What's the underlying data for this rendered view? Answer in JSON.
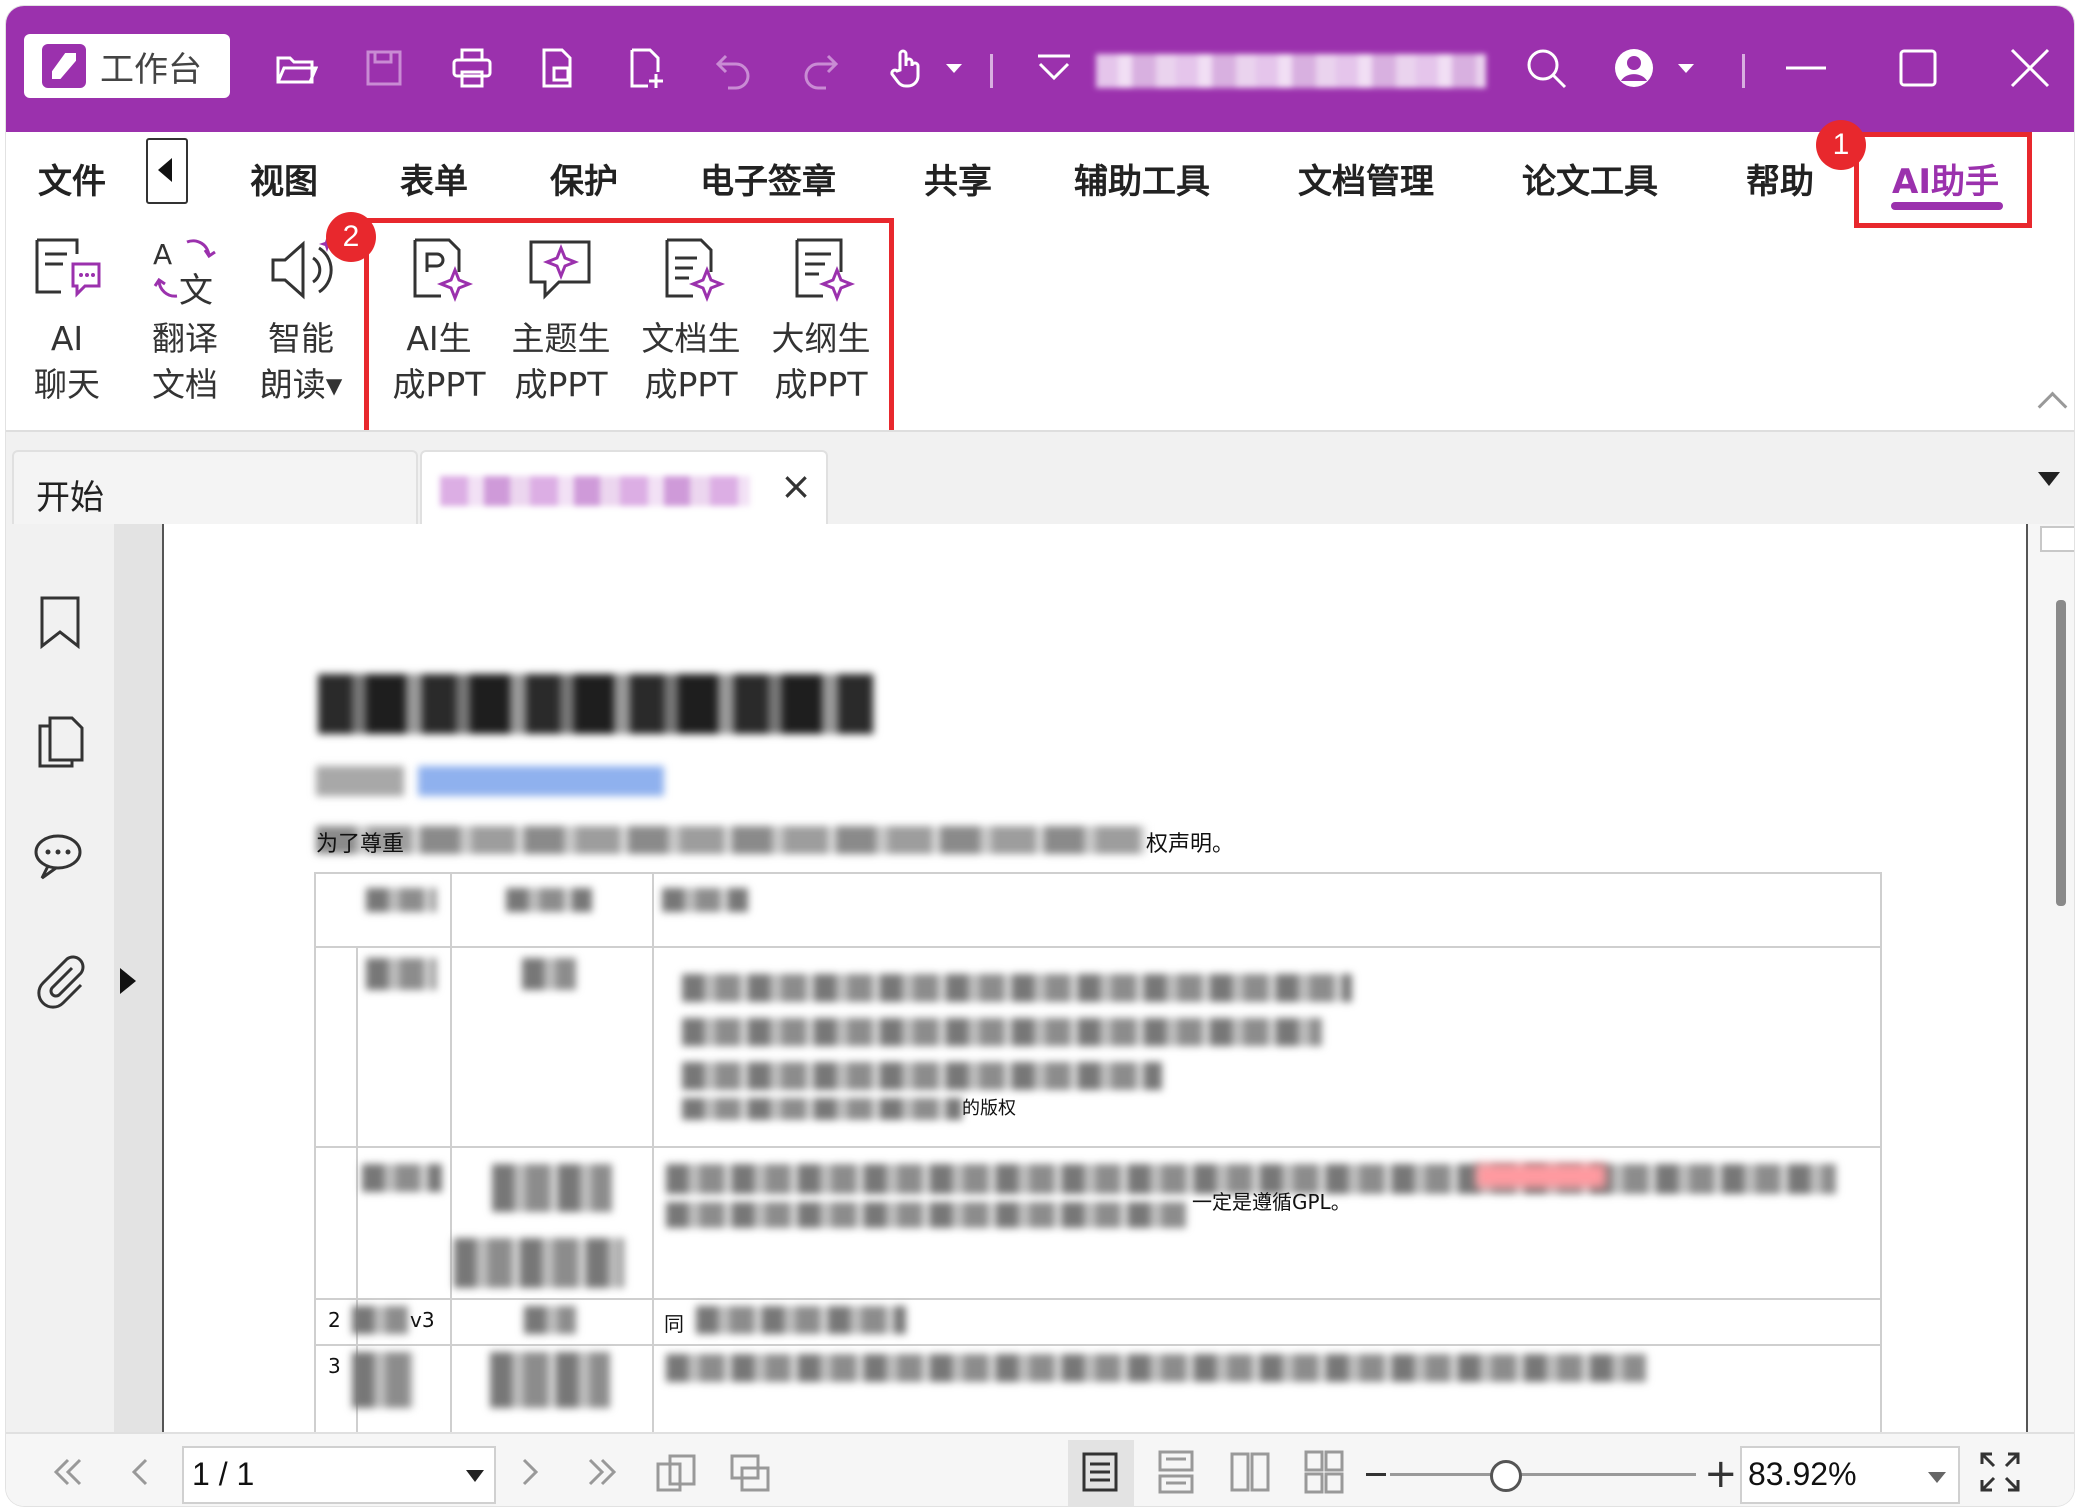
{
  "title_bar": {
    "workbench_label": "工作台",
    "icons": [
      "folder-open-icon",
      "save-icon",
      "print-icon",
      "page-icon",
      "new-page-icon",
      "undo-icon",
      "redo-icon",
      "hand-tool-icon",
      "quick-access-dropdown-icon",
      "search-icon",
      "account-icon",
      "minimize-icon",
      "maximize-icon",
      "close-icon"
    ]
  },
  "menu": {
    "items": [
      {
        "label": "文件"
      },
      {
        "label": "视图"
      },
      {
        "label": "表单"
      },
      {
        "label": "保护"
      },
      {
        "label": "电子签章"
      },
      {
        "label": "共享"
      },
      {
        "label": "辅助工具"
      },
      {
        "label": "文档管理"
      },
      {
        "label": "论文工具"
      },
      {
        "label": "帮助"
      },
      {
        "label": "AI助手",
        "active": true
      }
    ]
  },
  "badges": {
    "first": "1",
    "second": "2"
  },
  "ribbon": {
    "ai_chat": "AI\n聊天",
    "translate_doc": "翻译\n文档",
    "smart_read": "智能\n朗读▾",
    "ai_gen_ppt": "AI生\n成PPT",
    "topic_gen_ppt": "主题生\n成PPT",
    "doc_gen_ppt": "文档生\n成PPT",
    "outline_gen_ppt": "大纲生\n成PPT"
  },
  "tabs": {
    "start_label": "开始",
    "close_glyph": "×"
  },
  "document": {
    "visible_fragments": {
      "line1_start": "为了尊重",
      "line1_end": "权声明。",
      "row2_text_end": "的版权",
      "row3_end": "一定是遵循GPL。",
      "row4_num": "2",
      "row4_tag": "v3",
      "row4_text": "同",
      "row5_num": "3"
    }
  },
  "status_bar": {
    "page_indicator": "1 / 1",
    "zoom_level": "83.92%",
    "zoom_fraction": 0.38
  },
  "colors": {
    "brand": "#9b31ad",
    "highlight_red": "#e8282d"
  }
}
